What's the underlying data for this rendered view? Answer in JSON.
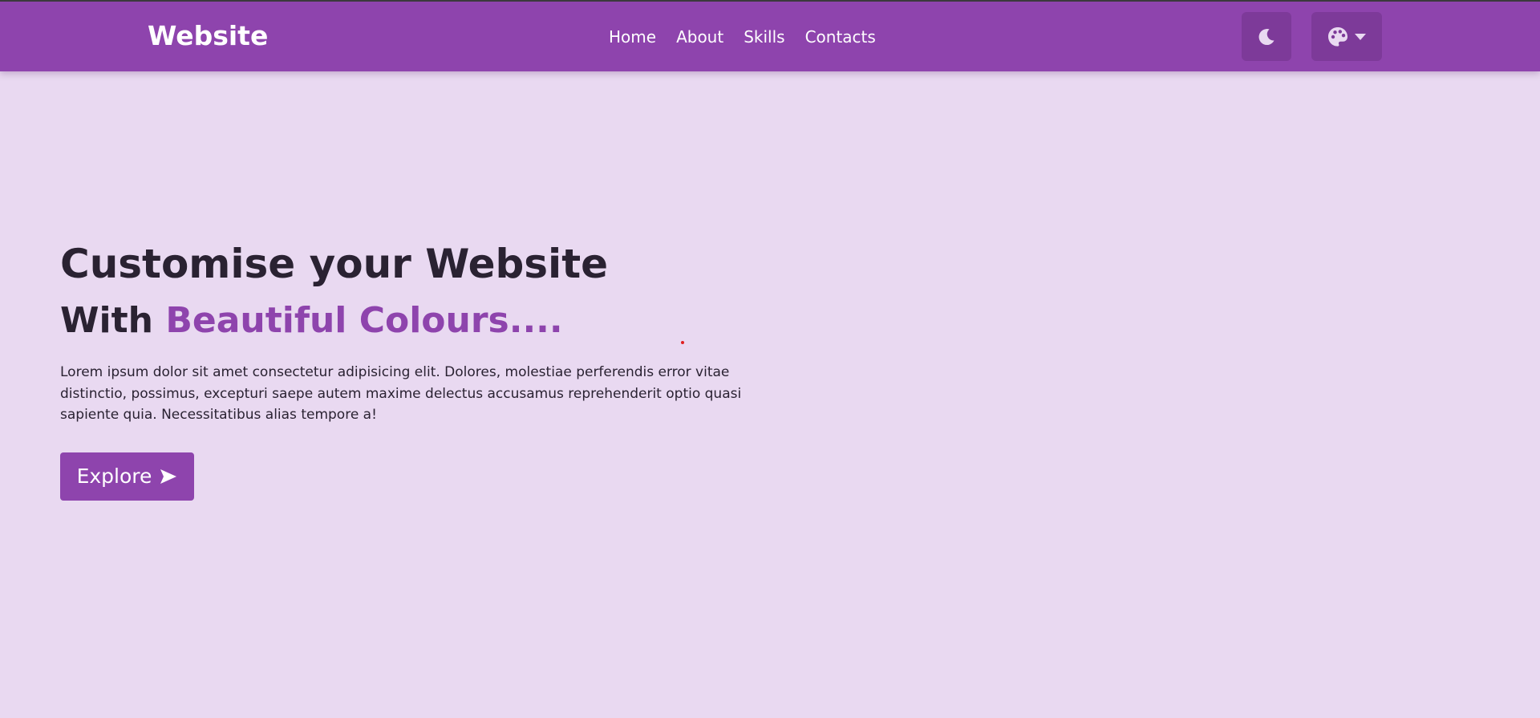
{
  "colors": {
    "accent": "#8e44ad",
    "background": "#e9d9f1",
    "text": "#2a2232",
    "button_bg": "#7d3a99"
  },
  "navbar": {
    "brand": "Website",
    "links": [
      "Home",
      "About",
      "Skills",
      "Contacts"
    ],
    "theme_toggle_icon": "moon-icon",
    "palette_icon": "palette-icon",
    "palette_dropdown_icon": "caret-down-icon"
  },
  "hero": {
    "title": "Customise your Website",
    "subtitle_prefix": "With",
    "subtitle_accent": "Beautiful Colours....",
    "description": "Lorem ipsum dolor sit amet consectetur adipisicing elit. Dolores, molestiae perferendis error vitae distinctio, possimus, excepturi saepe autem maxime delectus accusamus reprehenderit optio quasi sapiente quia. Necessitatibus alias tempore a!",
    "explore_label": "Explore",
    "explore_icon": "arrow-right-icon"
  }
}
